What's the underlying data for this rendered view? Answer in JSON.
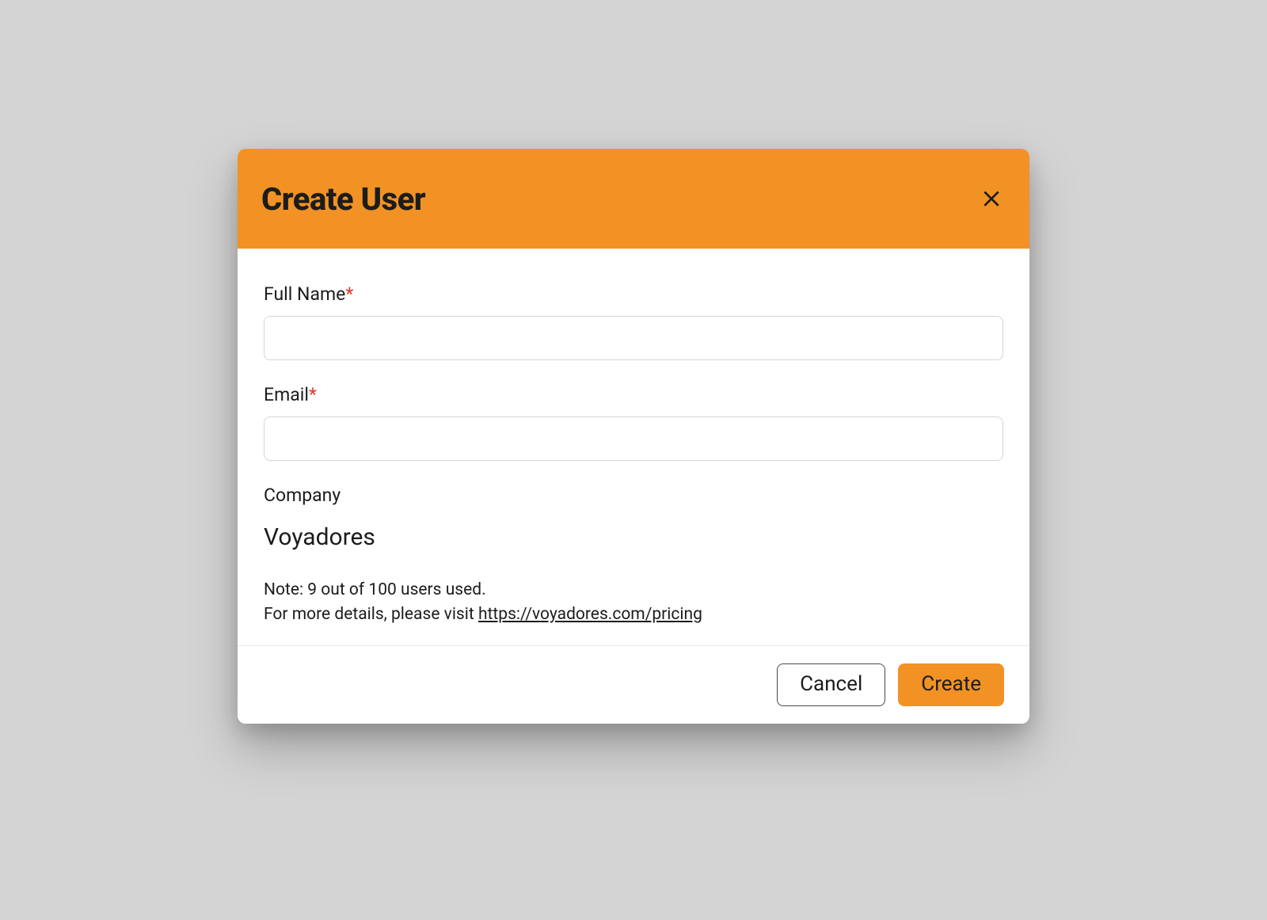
{
  "modal": {
    "title": "Create User",
    "fields": {
      "fullName": {
        "label": "Full Name",
        "required": "*",
        "value": ""
      },
      "email": {
        "label": "Email",
        "required": "*",
        "value": ""
      },
      "company": {
        "label": "Company",
        "value": "Voyadores"
      }
    },
    "note": {
      "line1": "Note: 9 out of 100 users used.",
      "line2_prefix": "For more details, please visit ",
      "link_text": "https://voyadores.com/pricing"
    },
    "buttons": {
      "cancel": "Cancel",
      "create": "Create"
    }
  }
}
